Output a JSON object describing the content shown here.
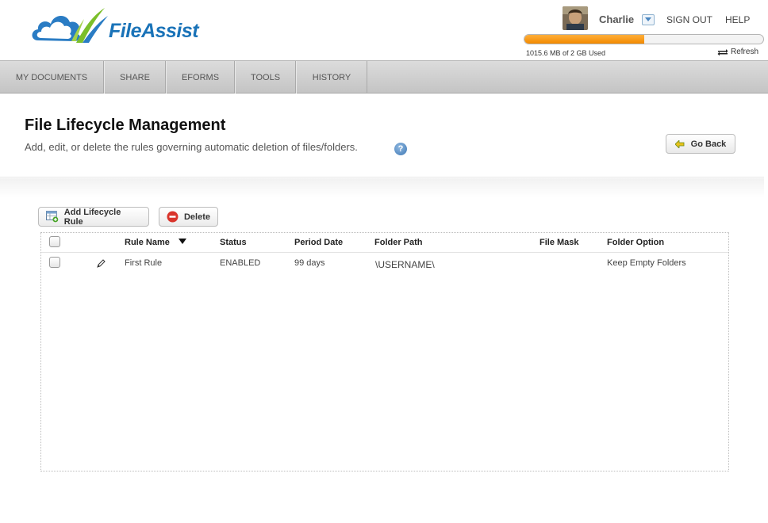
{
  "app": {
    "name": "FileAssist"
  },
  "user": {
    "name": "Charlie",
    "sign_out": "SIGN OUT",
    "help": "HELP"
  },
  "storage": {
    "used_fraction": 0.5,
    "label": "1015.6 MB of 2 GB Used",
    "refresh": "Refresh"
  },
  "nav": {
    "tabs": [
      "MY DOCUMENTS",
      "SHARE",
      "EFORMS",
      "TOOLS",
      "HISTORY"
    ]
  },
  "page": {
    "title": "File Lifecycle Management",
    "subtitle": "Add, edit, or delete the rules governing automatic deletion of files/folders.",
    "help_glyph": "?",
    "go_back": "Go Back"
  },
  "toolbar": {
    "add_rule": "Add Lifecycle Rule",
    "delete": "Delete"
  },
  "table": {
    "columns": {
      "rule_name": "Rule Name",
      "status": "Status",
      "period_date": "Period Date",
      "folder_path": "Folder Path",
      "file_mask": "File Mask",
      "folder_option": "Folder Option"
    },
    "rows": [
      {
        "rule_name": "First Rule",
        "status": "ENABLED",
        "period_date": "99 days",
        "folder_path": "\\USERNAME\\",
        "file_mask": "",
        "folder_option": "Keep Empty Folders"
      }
    ]
  },
  "colors": {
    "brand_blue": "#1a73b8",
    "quota_orange": "#f28a00",
    "delete_red": "#d9342b",
    "back_green": "#5a9a1a"
  },
  "icons": {
    "logo": "cloud-logo-icon",
    "dropdown": "chevron-down-icon",
    "refresh": "refresh-icon",
    "help": "help-icon",
    "back": "arrow-left-icon",
    "add": "add-table-icon",
    "delete": "minus-circle-icon",
    "sort": "sort-desc-icon",
    "edit": "pencil-icon"
  }
}
